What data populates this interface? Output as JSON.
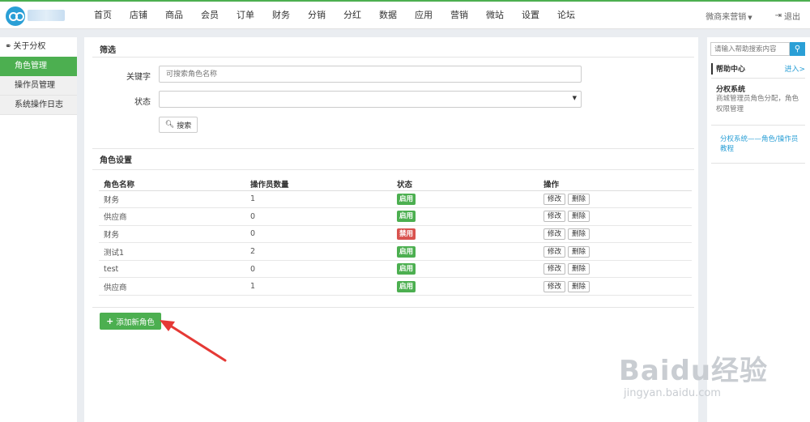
{
  "nav": {
    "items": [
      "首页",
      "店铺",
      "商品",
      "会员",
      "订单",
      "财务",
      "分销",
      "分红",
      "数据",
      "应用",
      "营销",
      "微站",
      "设置",
      "论坛"
    ],
    "merchant": "微商来营销",
    "logout": "退出"
  },
  "sidebar": {
    "header": "关于分权",
    "items": [
      {
        "label": "角色管理",
        "active": true
      },
      {
        "label": "操作员管理",
        "active": false
      },
      {
        "label": "系统操作日志",
        "active": false
      }
    ]
  },
  "filter": {
    "title": "筛选",
    "keyword_label": "关键字",
    "keyword_placeholder": "可搜索角色名称",
    "status_label": "状态",
    "search_button": "搜索"
  },
  "roles": {
    "title": "角色设置",
    "columns": [
      "角色名称",
      "操作员数量",
      "状态",
      "操作"
    ],
    "rows": [
      {
        "name": "财务",
        "count": "1",
        "status": "启用",
        "enabled": true
      },
      {
        "name": "供应商",
        "count": "0",
        "status": "启用",
        "enabled": true
      },
      {
        "name": "财务",
        "count": "0",
        "status": "禁用",
        "enabled": false
      },
      {
        "name": "测试1",
        "count": "2",
        "status": "启用",
        "enabled": true
      },
      {
        "name": "test",
        "count": "0",
        "status": "启用",
        "enabled": true
      },
      {
        "name": "供应商",
        "count": "1",
        "status": "启用",
        "enabled": true
      }
    ],
    "edit_label": "修改",
    "delete_label": "删除",
    "add_button": "添加新角色"
  },
  "help": {
    "search_placeholder": "请输入帮助搜索内容",
    "center": "帮助中心",
    "enter": "进入>",
    "system_title": "分权系统",
    "system_desc": "商城管理员角色分配，角色权限管理",
    "link": "分权系统——角色/操作员教程"
  },
  "watermark": {
    "main": "Baidu经验",
    "sub": "jingyan.baidu.com"
  },
  "colors": {
    "accent": "#4caf50",
    "danger": "#d9534f",
    "link": "#2a9fd6",
    "annotation_arrow": "#e53935"
  }
}
